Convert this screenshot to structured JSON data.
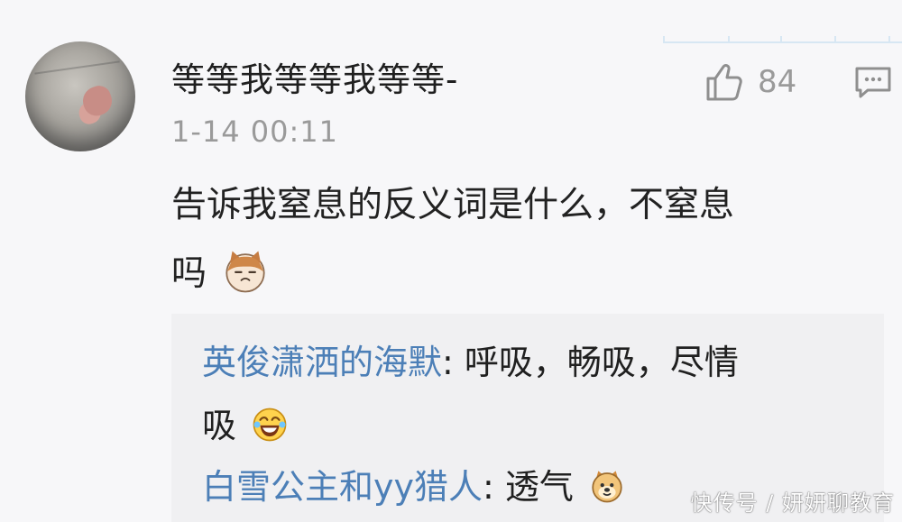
{
  "comment": {
    "username": "等等我等等我等等-",
    "timestamp": "1-14 00:11",
    "text_line1": "告诉我窒息的反义词是什么，不窒息",
    "text_line2": "吗",
    "likes": "84",
    "icons": {
      "like": "thumbs-up-icon",
      "reply": "comment-icon",
      "emoji": "cat-emoji-icon"
    }
  },
  "replies": [
    {
      "name": "英俊潇洒的海默",
      "colon": ":",
      "text_line1": "呼吸，畅吸，尽情",
      "text_line2": "吸",
      "emoji": "laughing-emoji-icon"
    },
    {
      "name": "白雪公主和yy猎人",
      "colon": ":",
      "text_line1": "透气",
      "emoji": "dog-emoji-icon"
    }
  ],
  "watermark": "快传号 / 妍妍聊教育"
}
